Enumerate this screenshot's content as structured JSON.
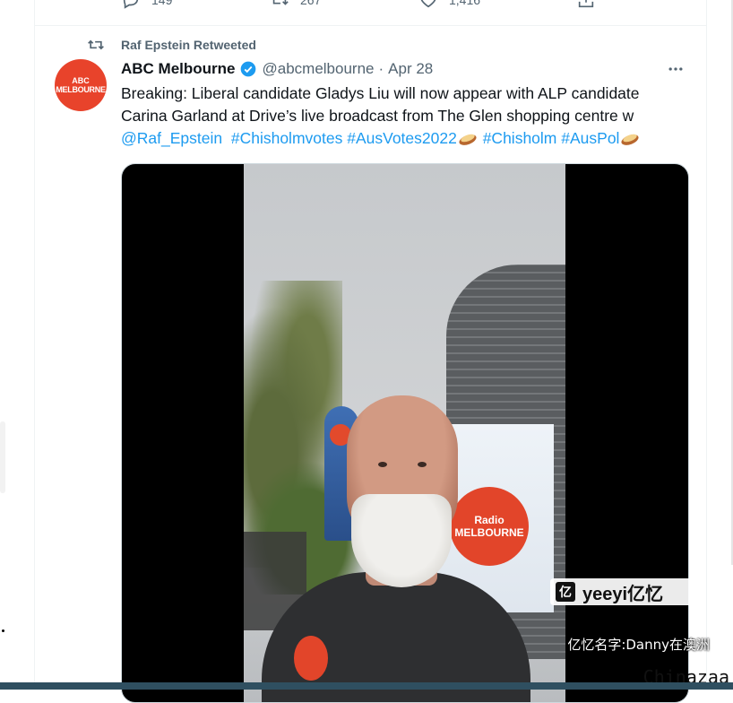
{
  "previous_tweet_actions": {
    "reply_count": "149",
    "retweet_count": "267",
    "like_count": "1,416"
  },
  "tweet": {
    "retweeted_by": "Raf Epstein Retweeted",
    "avatar_label_top": "ABC",
    "avatar_label": "MELBOURNE",
    "display_name": "ABC Melbourne",
    "handle": "@abcmelbourne",
    "separator": "·",
    "date": "Apr 28",
    "text_line1": "Breaking: Liberal candidate Gladys Liu will now appear with ALP candidate",
    "text_line2": "Carina Garland at Drive’s live broadcast from The Glen shopping centre w",
    "mention": "@Raf_Epstein",
    "hashtags": [
      "#Chisholmvotes",
      "#AusVotes2022",
      "#Chisholm",
      "#AusPol"
    ],
    "media": {
      "banner_text": "Radio MELBOURNE"
    }
  },
  "watermark": {
    "badge_icon": "亿",
    "badge_text": "yeeyi亿忆",
    "caption": "亿忆名字:Danny在澳洲",
    "corner": "Chinazaa"
  },
  "colors": {
    "link": "#1d9bf0",
    "text_primary": "#0f1419",
    "text_secondary": "#536471",
    "abc_red": "#e8432b"
  }
}
